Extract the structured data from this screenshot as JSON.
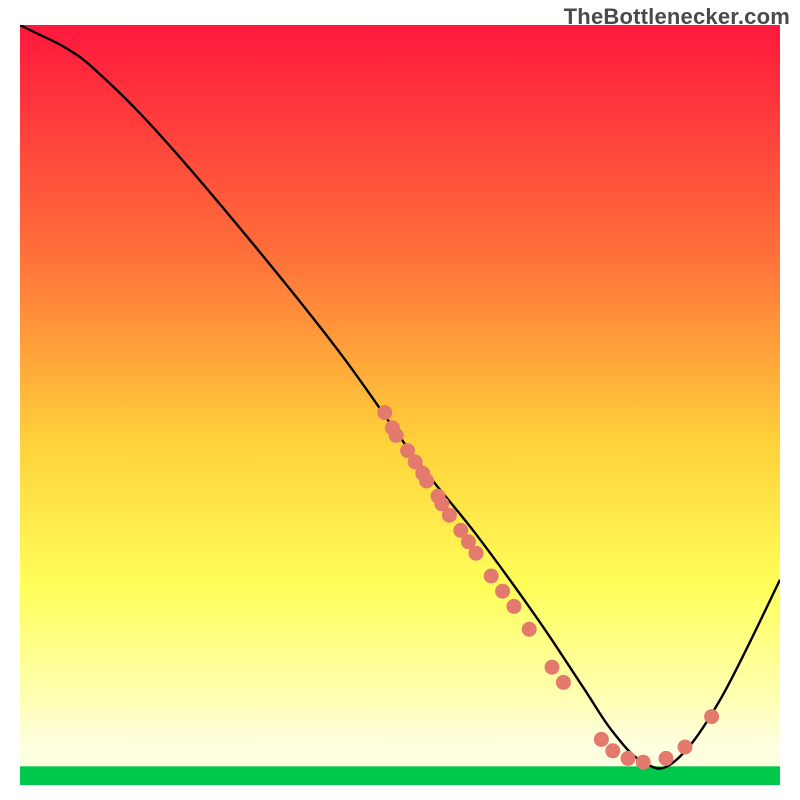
{
  "watermark": "TheBottlenecker.com",
  "colors": {
    "gradient_top": "#ff183d",
    "gradient_mid1": "#ff6f3a",
    "gradient_mid2": "#ffd23a",
    "gradient_mid3": "#ffff5a",
    "gradient_mid4": "#ffffb0",
    "gradient_bottom_high": "#feffe1",
    "gradient_green": "#00c84a",
    "curve": "#000000",
    "dot_fill": "#e47a6e",
    "dot_stroke": "#a3483f"
  },
  "chart_data": {
    "type": "line",
    "title": "",
    "xlabel": "",
    "ylabel": "",
    "xlim": [
      0,
      100
    ],
    "ylim": [
      0,
      100
    ],
    "series": [
      {
        "name": "bottleneck-curve",
        "x": [
          0,
          2,
          6,
          10,
          18,
          30,
          42,
          52,
          60,
          68,
          74,
          78,
          82,
          86,
          92,
          100
        ],
        "y": [
          100,
          99,
          97,
          94,
          86,
          72,
          57,
          43,
          33,
          22,
          13,
          7,
          3,
          3,
          11,
          27
        ]
      }
    ],
    "scatter": [
      {
        "name": "data-points",
        "points": [
          [
            48,
            49
          ],
          [
            49,
            47
          ],
          [
            49.5,
            46
          ],
          [
            51,
            44
          ],
          [
            52,
            42.5
          ],
          [
            53,
            41
          ],
          [
            53.5,
            40
          ],
          [
            55,
            38
          ],
          [
            55.5,
            37
          ],
          [
            56.5,
            35.5
          ],
          [
            58,
            33.5
          ],
          [
            59,
            32
          ],
          [
            60,
            30.5
          ],
          [
            62,
            27.5
          ],
          [
            63.5,
            25.5
          ],
          [
            65,
            23.5
          ],
          [
            67,
            20.5
          ],
          [
            70,
            15.5
          ],
          [
            71.5,
            13.5
          ],
          [
            76.5,
            6
          ],
          [
            78,
            4.5
          ],
          [
            80,
            3.5
          ],
          [
            82,
            3
          ],
          [
            85,
            3.5
          ],
          [
            87.5,
            5
          ],
          [
            91,
            9
          ]
        ]
      }
    ]
  }
}
